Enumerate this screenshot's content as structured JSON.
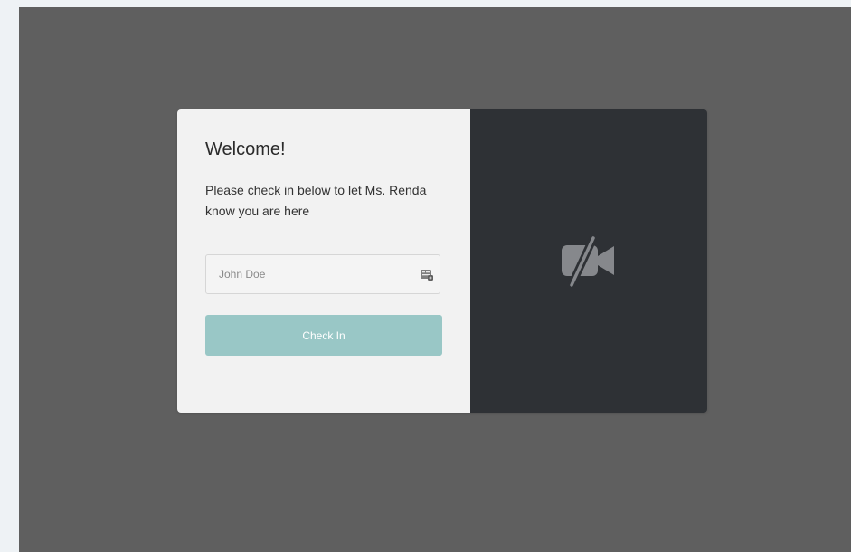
{
  "welcome": {
    "title": "Welcome!",
    "description": "Please check in below to let Ms. Renda know you are here"
  },
  "form": {
    "name_placeholder": "John Doe",
    "name_value": "",
    "submit_label": "Check In",
    "button_color": "#99c7c6"
  },
  "video": {
    "icon": "video-off-icon"
  },
  "icons": {
    "input_icon": "contact-card-icon"
  }
}
